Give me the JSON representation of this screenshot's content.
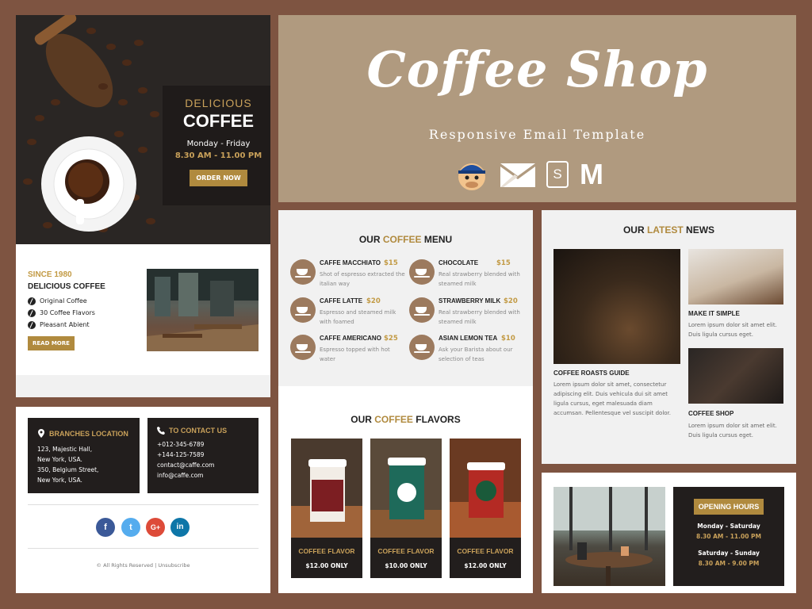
{
  "hero": {
    "kicker": "DELICIOUS",
    "title": "COFFEE",
    "days": "Monday - Friday",
    "hours": "8.30 AM - 11.00 PM",
    "button": "ORDER NOW"
  },
  "about": {
    "since": "SINCE 1980",
    "title": "DELICIOUS COFFEE",
    "items": [
      "Original Coffee",
      "30 Coffee Flavors",
      "Pleasant Abient"
    ],
    "button": "READ MORE"
  },
  "branches": {
    "title": "BRANCHES LOCATION",
    "lines": [
      "123, Majestic Hall,",
      "New York, USA.",
      "350, Belgium Street,",
      "New York, USA."
    ]
  },
  "contact": {
    "title": "TO CONTACT US",
    "lines": [
      "+012-345-6789",
      "+144-125-7589",
      "contact@caffe.com",
      "info@caffe.com"
    ]
  },
  "social": {
    "icons": [
      "facebook-icon",
      "twitter-icon",
      "google-plus-icon",
      "linkedin-icon"
    ],
    "labels": [
      "f",
      "t",
      "G+",
      "in"
    ],
    "colors": [
      "#3b5998",
      "#55acee",
      "#dd4b39",
      "#0e76a8"
    ]
  },
  "footer": "© All Rights Reserved | Unsubscribe",
  "banner": {
    "title": "Coffee Shop",
    "subtitle": "Responsive Email Template",
    "logos": [
      "mailchimp-icon",
      "campaign-monitor-icon",
      "stampready-icon",
      "mailster-icon"
    ],
    "logo_labels": [
      "",
      "",
      "S",
      "M"
    ]
  },
  "menu": {
    "heading_a": "OUR ",
    "heading_b": "COFFEE",
    "heading_c": " MENU",
    "items": [
      {
        "name": "CAFFE MACCHIATO",
        "price": "$15",
        "desc": "Shot of espresso extracted the italian way"
      },
      {
        "name": "CHOCOLATE",
        "price": "$15",
        "desc": "Real strawberry blended with steamed milk"
      },
      {
        "name": "CAFFE LATTE",
        "price": "$20",
        "desc": "Espresso and steamed milk with foamed"
      },
      {
        "name": "STRAWBERRY MILK",
        "price": "$20",
        "desc": "Real strawberry blended with steamed milk"
      },
      {
        "name": "CAFFE AMERICANO",
        "price": "$25",
        "desc": "Espresso topped with hot water"
      },
      {
        "name": "ASIAN LEMON TEA",
        "price": "$10",
        "desc": "Ask your Barista about our selection of teas"
      }
    ]
  },
  "flavors": {
    "heading_a": "OUR ",
    "heading_b": "COFFEE",
    "heading_c": " FLAVORS",
    "items": [
      {
        "name": "COFFEE FLAVOR",
        "price": "$12.00 ONLY"
      },
      {
        "name": "COFFEE FLAVOR",
        "price": "$10.00 ONLY"
      },
      {
        "name": "COFFEE FLAVOR",
        "price": "$12.00 ONLY"
      }
    ]
  },
  "news": {
    "heading_a": "OUR ",
    "heading_b": "LATEST",
    "heading_c": " NEWS",
    "articles": [
      {
        "title": "COFFEE ROASTS GUIDE",
        "text": "Lorem ipsum dolor sit amet, consectetur adipiscing elit. Duis vehicula dui sit amet ligula cursus, eget malesuada diam accumsan. Pellentesque vel suscipit dolor."
      },
      {
        "title": "MAKE IT SIMPLE",
        "text": "Lorem ipsum dolor sit amet elit. Duis ligula cursus eget."
      },
      {
        "title": "COFFEE SHOP",
        "text": "Lorem ipsum dolor sit amet elit. Duis ligula cursus eget."
      }
    ]
  },
  "opening": {
    "title": "OPENING HOURS",
    "days1": "Monday - Saturday",
    "hours1": "8.30 AM - 11.00 PM",
    "days2": "Saturday - Sunday",
    "hours2": "8.30 AM - 9.00 PM"
  }
}
